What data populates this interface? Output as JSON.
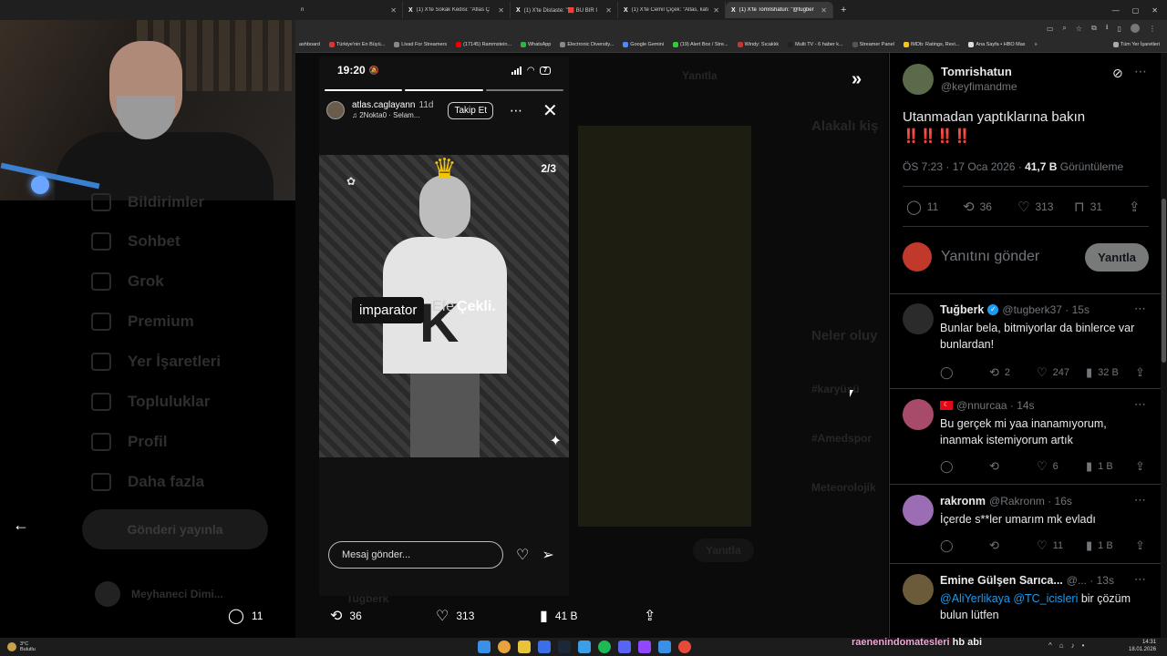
{
  "browser": {
    "tabs": [
      {
        "title": "n",
        "active": false
      },
      {
        "title": "(1) X'te Sokak Kedisi: \"Atlas Ç",
        "active": false
      },
      {
        "title": "(1) X'te Distaste: \"🟥 BU BİR İ",
        "active": false
      },
      {
        "title": "(1) X'te Cemil Çiçek: \"Atlas, kati",
        "active": false
      },
      {
        "title": "(1) X'te Tomrishatun: \"@tugber",
        "active": true
      }
    ],
    "bookmarks": [
      "ashboard",
      "Türkiye'nin En Büyü...",
      "Livad For Streamers",
      "(17145) Rammstein...",
      "WhatsApp",
      "Electronic Diversity...",
      "Google Gemini",
      "(19) Alert Box / Stre...",
      "Windy: Sıcaklık",
      "Multi TV - 6 haber k...",
      "Streamer Panel",
      "IMDb: Ratings, Revi...",
      "Ana Sayfa • HBO Max"
    ],
    "bookmarks_folder": "Tüm Yer İşaretleri"
  },
  "sidebar": {
    "items": [
      "Bildirimler",
      "Sohbet",
      "Grok",
      "Premium",
      "Yer İşaretleri",
      "Topluluklar",
      "Profil",
      "Daha fazla"
    ],
    "post_button": "Gönderi yayınla",
    "user_name": "Meyhaneci Dimi..."
  },
  "center_ghost": {
    "reply_label": "Yanıtla",
    "section_related": "Alakalı kiş",
    "section_news": "Neler oluy",
    "tag1": "#karyüşü",
    "tag2": "#Amedspor",
    "tag3": "Meteorolojik",
    "ghost_user": "Tuğberk",
    "ghost_reply": "Yanıtla"
  },
  "story": {
    "time": "19:20",
    "battery": "7",
    "username": "atlas.caglayann",
    "ago": "11d",
    "music": "2Nokta0 · Selam...",
    "follow": "Takip Et",
    "counter": "2/3",
    "badge_imparator": "imparator",
    "badge_efe": "Efe",
    "badge_cekli": "Çekli.",
    "message_placeholder": "Mesaj gönder..."
  },
  "modal_actions": {
    "replies": "11",
    "reposts": "36",
    "likes": "313",
    "views": "41 B"
  },
  "main_post": {
    "name": "Tomrishatun",
    "handle": "@keyfimandme",
    "text": "Utanmadan yaptıklarına bakın",
    "bangs": "‼️‼️‼️‼️",
    "meta_time": "ÖS 7:23 · 17 Oca 2026 · ",
    "meta_views": "41,7 B",
    "meta_views_label": " Görüntüleme",
    "stats": {
      "replies": "11",
      "reposts": "36",
      "likes": "313",
      "bookmarks": "31"
    }
  },
  "reply_box": {
    "placeholder": "Yanıtını gönder",
    "button": "Yanıtla"
  },
  "replies": [
    {
      "name": "Tuğberk",
      "handle": "@tugberk37 · 15s",
      "verified": true,
      "flag": false,
      "text": "Bunlar bela, bitmiyorlar da binlerce var bunlardan!",
      "reposts": "2",
      "likes": "247",
      "views": "32 B",
      "avatar_color": "#2b2b2b"
    },
    {
      "name": "",
      "handle": "@nnurcaa · 14s",
      "verified": false,
      "flag": true,
      "text": "Bu gerçek mi yaa inanamıyorum, inanmak istemiyorum artık",
      "reposts": "",
      "likes": "6",
      "views": "1 B",
      "avatar_color": "#a84a6a"
    },
    {
      "name": "rakronm",
      "handle": "@Rakronm · 16s",
      "verified": false,
      "flag": false,
      "text": "İçerde s**ler umarım mk evladı",
      "reposts": "",
      "likes": "11",
      "views": "1 B",
      "avatar_color": "#9b6db5"
    },
    {
      "name": "Emine Gülşen Sarıca...",
      "handle": "@... · 13s",
      "verified": false,
      "flag": false,
      "mention1": "@AliYerlikaya",
      "mention2": "@TC_icisleri",
      "text": " bir çözüm bulun lütfen",
      "avatar_color": "#6b5b3b"
    }
  ],
  "taskbar": {
    "temp": "3°C",
    "weather": "Bulutlu",
    "time": "14:31",
    "date": "18.01.2026"
  },
  "stream_overlay": {
    "user": "raenenindomatesleri",
    "message": "hb abi"
  },
  "colors": {
    "x_blue": "#1d9bf0",
    "x_gray": "#71767b",
    "x_text": "#e7e9ea",
    "alert_red": "#f4212e",
    "crown_gold": "#f5c400"
  }
}
